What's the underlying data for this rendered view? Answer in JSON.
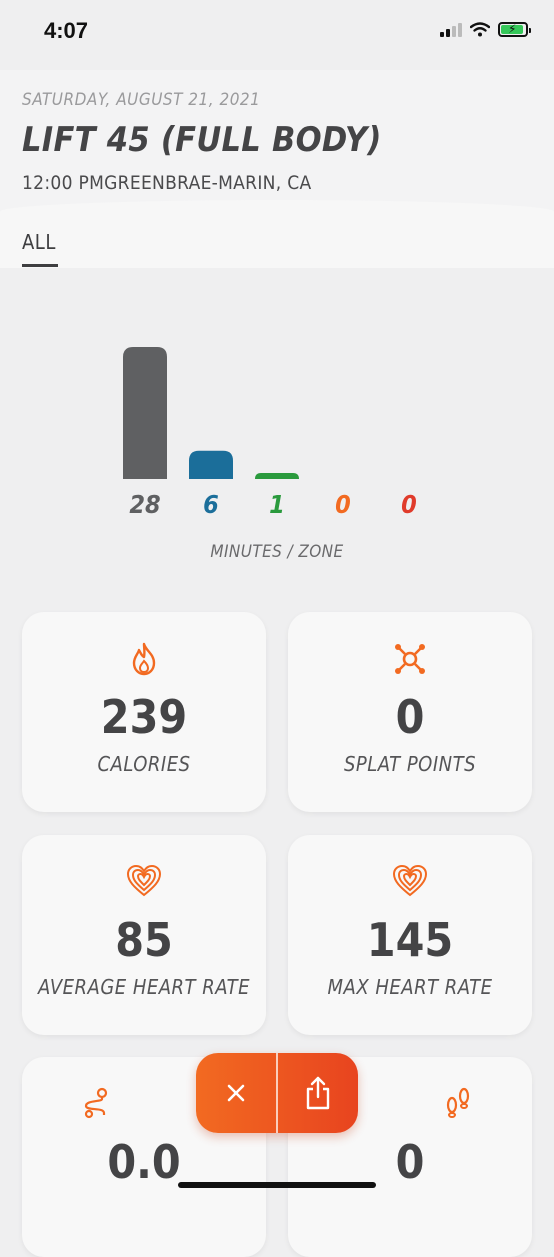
{
  "status": {
    "time": "4:07"
  },
  "workout": {
    "date": "SATURDAY, AUGUST 21, 2021",
    "title": "LIFT 45 (FULL BODY)",
    "subline": "12:00 PMGREENBRAE-MARIN, CA"
  },
  "tabs": {
    "active": "ALL"
  },
  "colors": {
    "zone_gray": "#5f6062",
    "zone_blue": "#1b6e9a",
    "zone_green": "#2a9a3d",
    "zone_orange": "#f26a21",
    "zone_red": "#e03b2b",
    "accent": "#f26a21"
  },
  "chart_data": {
    "type": "bar",
    "categories": [
      "gray",
      "blue",
      "green",
      "orange",
      "red"
    ],
    "values": [
      28,
      6,
      1,
      0,
      0
    ],
    "labels": [
      "28",
      "6",
      "1",
      "0",
      "0"
    ],
    "xlabel": "MINUTES / ZONE",
    "ylim": [
      0,
      28
    ],
    "grid": false
  },
  "stats": [
    {
      "value": "239",
      "label": "CALORIES",
      "icon": "flame-icon"
    },
    {
      "value": "0",
      "label": "SPLAT POINTS",
      "icon": "splat-icon"
    },
    {
      "value": "85",
      "label": "AVERAGE HEART RATE",
      "icon": "heart-icon"
    },
    {
      "value": "145",
      "label": "MAX HEART RATE",
      "icon": "heart-icon"
    },
    {
      "value": "0.0",
      "label": "",
      "icon": "route-icon"
    },
    {
      "value": "0",
      "label": "",
      "icon": "footsteps-icon"
    }
  ],
  "actions": {
    "close_icon": "close-icon",
    "share_icon": "share-icon"
  }
}
